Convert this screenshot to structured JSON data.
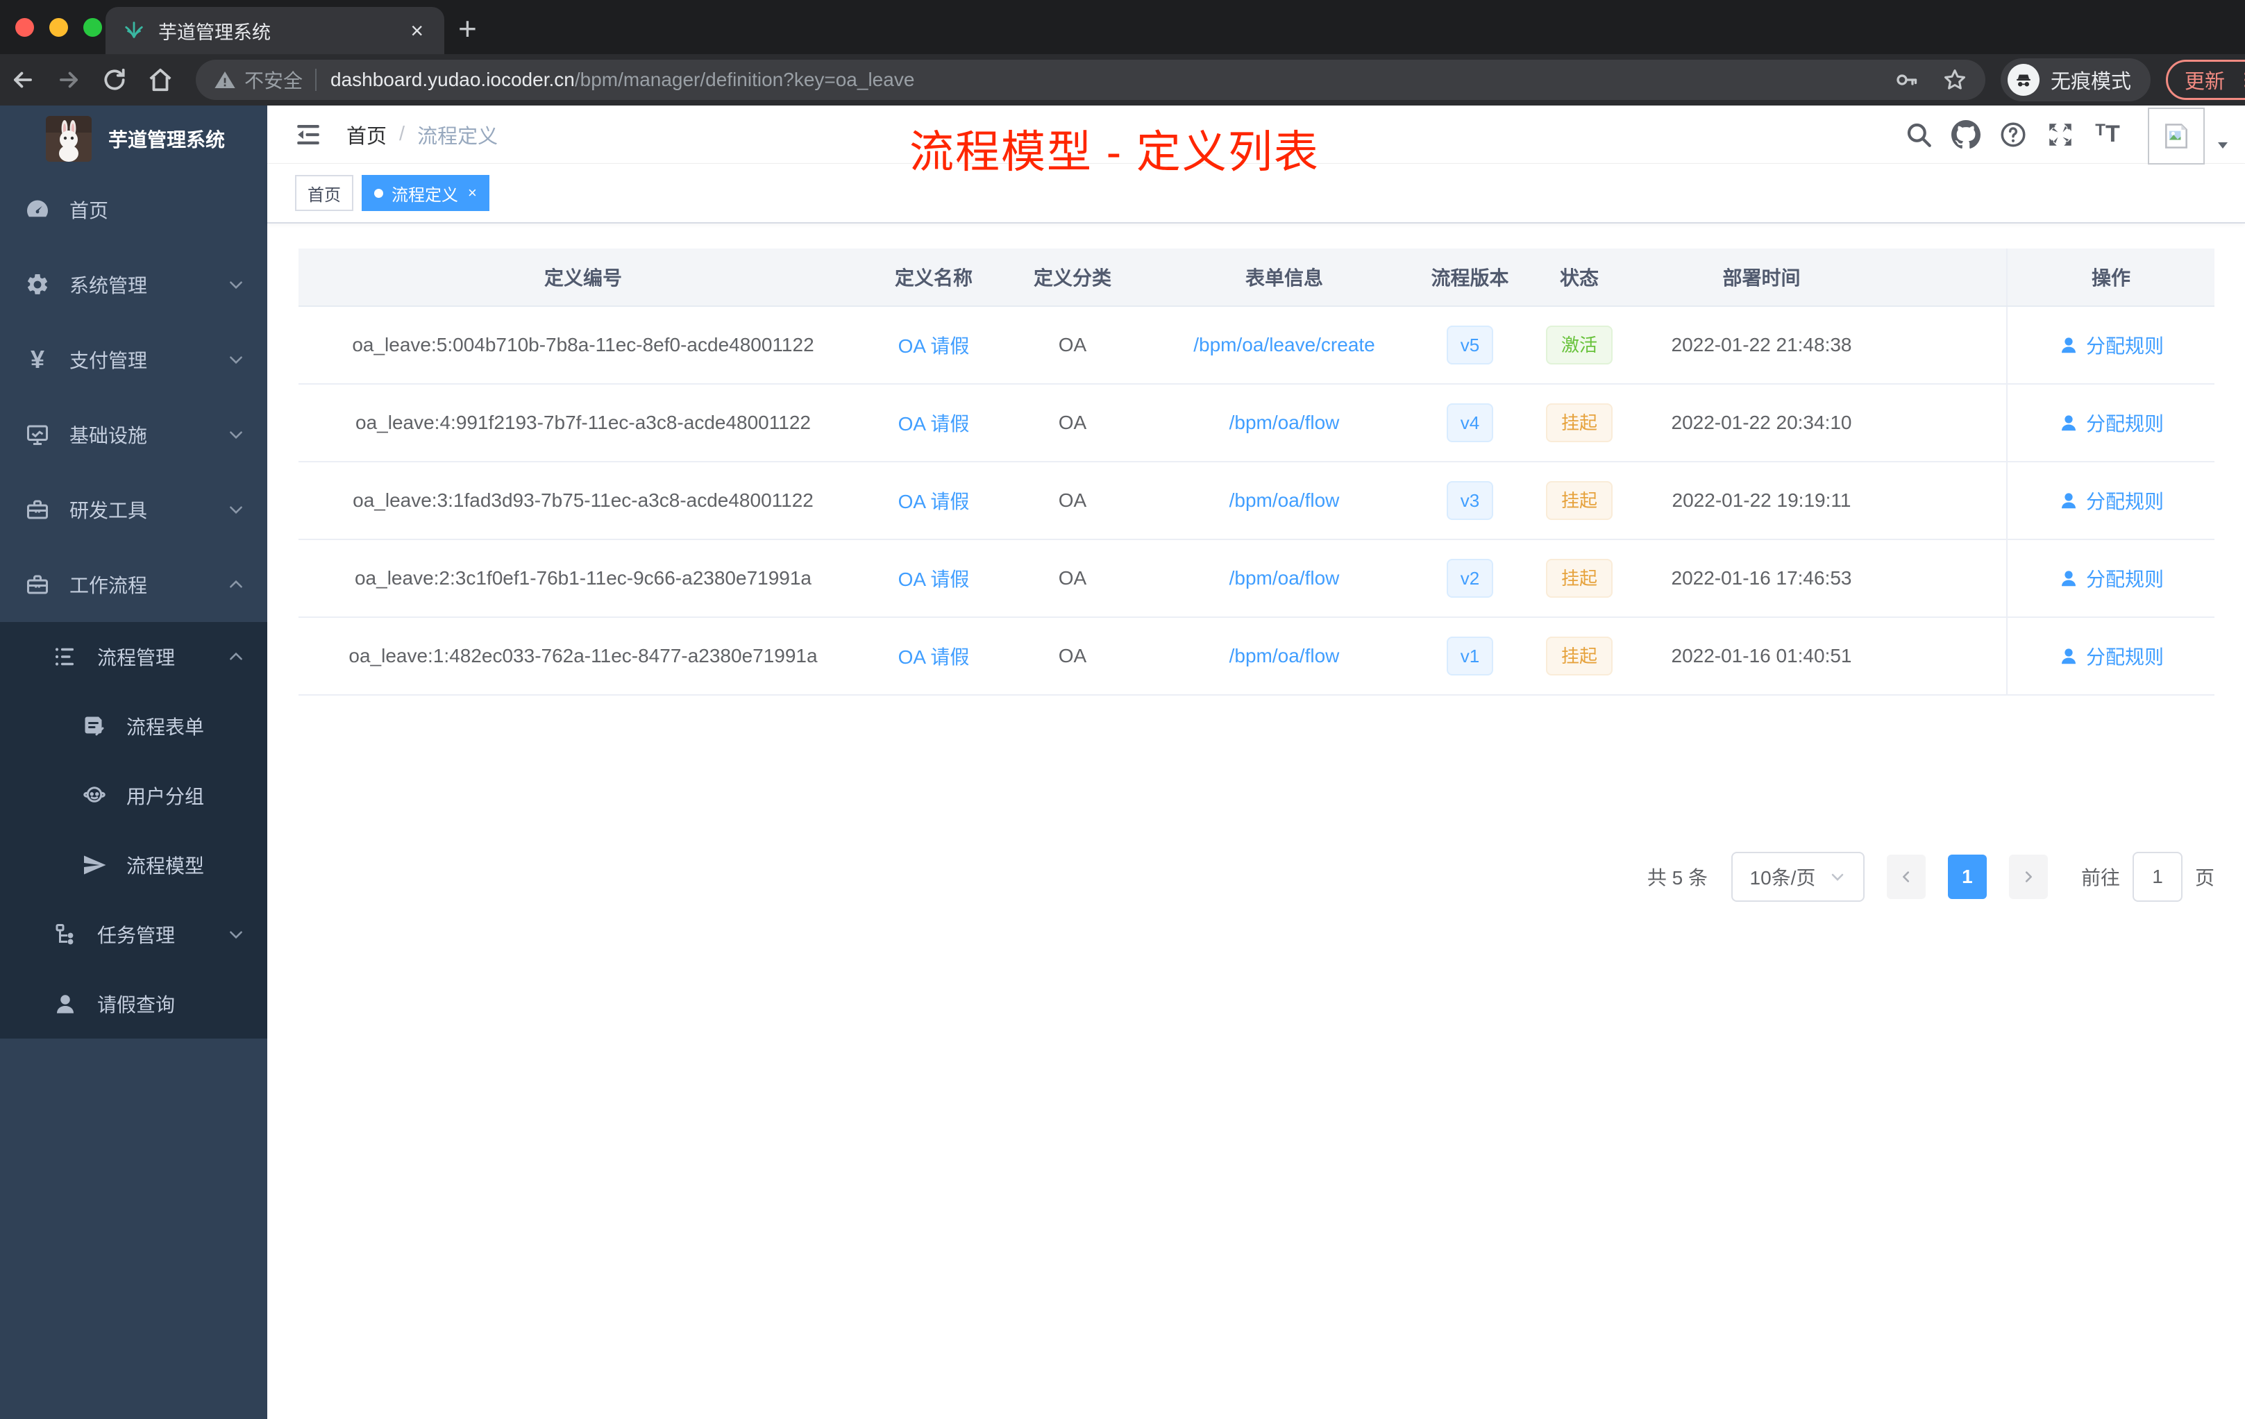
{
  "colors": {
    "accent_blue": "#409eff",
    "success_green": "#67c23a",
    "warning_orange": "#e6a23c",
    "annotation_red": "#ff2600",
    "sidebar_bg": "#304156",
    "submenu_bg": "#1f2d3d",
    "chrome_error_pink": "#f28b82"
  },
  "browser": {
    "tab": {
      "title": "芋道管理系统",
      "close_glyph": "×",
      "new_tab_glyph": "+"
    },
    "address": {
      "security_label": "不安全",
      "host": "dashboard.yudao.iocoder.cn",
      "path": "/bpm/manager/definition?key=oa_leave",
      "incognito_label": "无痕模式",
      "update_label": "更新"
    }
  },
  "sidebar": {
    "logo_title": "芋道管理系统",
    "menu": [
      {
        "label": "首页",
        "icon": "dashboard-icon"
      },
      {
        "label": "系统管理",
        "icon": "gear-icon",
        "chevron": "down"
      },
      {
        "label": "支付管理",
        "icon": "yen-icon",
        "chevron": "down",
        "yen_glyph": "¥"
      },
      {
        "label": "基础设施",
        "icon": "monitor-icon",
        "chevron": "down"
      },
      {
        "label": "研发工具",
        "icon": "toolbox-icon",
        "chevron": "down"
      },
      {
        "label": "工作流程",
        "icon": "workflow-icon",
        "chevron": "up"
      }
    ],
    "submenu": [
      {
        "label": "流程管理",
        "icon": "list-tree-icon",
        "chevron": "up",
        "level": 2
      },
      {
        "label": "流程表单",
        "icon": "form-doc-icon",
        "level": 3
      },
      {
        "label": "用户分组",
        "icon": "user-group-icon",
        "level": 3
      },
      {
        "label": "流程模型",
        "icon": "paper-plane-icon",
        "level": 3
      },
      {
        "label": "任务管理",
        "icon": "task-tree-icon",
        "chevron": "down",
        "level": 2
      },
      {
        "label": "请假查询",
        "icon": "person-icon",
        "level": 2
      }
    ]
  },
  "header": {
    "breadcrumb": {
      "home": "首页",
      "separator": "/",
      "current": "流程定义"
    },
    "annotation": "流程模型 - 定义列表"
  },
  "tags": [
    {
      "label": "首页",
      "active": false
    },
    {
      "label": "流程定义",
      "active": true,
      "close_glyph": "×"
    }
  ],
  "table": {
    "columns": [
      "定义编号",
      "定义名称",
      "定义分类",
      "表单信息",
      "流程版本",
      "状态",
      "部署时间",
      "操作"
    ],
    "rows": [
      {
        "id": "oa_leave:5:004b710b-7b8a-11ec-8ef0-acde48001122",
        "name": "OA 请假",
        "category": "OA",
        "form": "/bpm/oa/leave/create",
        "version": "v5",
        "status": "激活",
        "status_type": "success",
        "deployed": "2022-01-22 21:48:38",
        "action": "分配规则"
      },
      {
        "id": "oa_leave:4:991f2193-7b7f-11ec-a3c8-acde48001122",
        "name": "OA 请假",
        "category": "OA",
        "form": "/bpm/oa/flow",
        "version": "v4",
        "status": "挂起",
        "status_type": "warning",
        "deployed": "2022-01-22 20:34:10",
        "action": "分配规则"
      },
      {
        "id": "oa_leave:3:1fad3d93-7b75-11ec-a3c8-acde48001122",
        "name": "OA 请假",
        "category": "OA",
        "form": "/bpm/oa/flow",
        "version": "v3",
        "status": "挂起",
        "status_type": "warning",
        "deployed": "2022-01-22 19:19:11",
        "action": "分配规则"
      },
      {
        "id": "oa_leave:2:3c1f0ef1-76b1-11ec-9c66-a2380e71991a",
        "name": "OA 请假",
        "category": "OA",
        "form": "/bpm/oa/flow",
        "version": "v2",
        "status": "挂起",
        "status_type": "warning",
        "deployed": "2022-01-16 17:46:53",
        "action": "分配规则"
      },
      {
        "id": "oa_leave:1:482ec033-762a-11ec-8477-a2380e71991a",
        "name": "OA 请假",
        "category": "OA",
        "form": "/bpm/oa/flow",
        "version": "v1",
        "status": "挂起",
        "status_type": "warning",
        "deployed": "2022-01-16 01:40:51",
        "action": "分配规则"
      }
    ]
  },
  "pagination": {
    "total_text": "共 5 条",
    "page_size": "10条/页",
    "prev_glyph": "‹",
    "current_page": "1",
    "next_glyph": "›",
    "goto_label": "前往",
    "goto_value": "1",
    "goto_suffix": "页"
  }
}
